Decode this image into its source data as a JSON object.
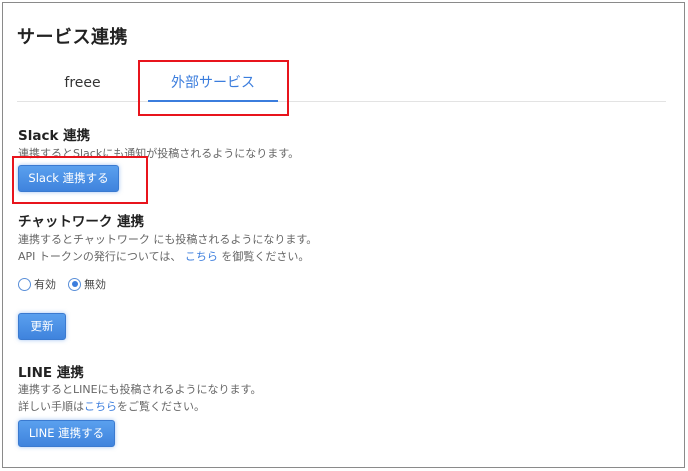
{
  "page": {
    "title": "サービス連携"
  },
  "tabs": [
    {
      "label": "freee",
      "active": false
    },
    {
      "label": "外部サービス",
      "active": true
    }
  ],
  "slack": {
    "title": "Slack 連携",
    "description": "連携するとSlackにも通知が投稿されるようになります。",
    "button_label": "Slack 連携する"
  },
  "chatwork": {
    "title": "チャットワーク 連携",
    "description_line1": "連携するとチャットワーク にも投稿されるようになります。",
    "description_line2_prefix": "API トークンの発行については、",
    "description_line2_link": "こちら",
    "description_line2_suffix": "を御覧ください。",
    "radio_options": [
      {
        "label": "有効",
        "checked": false
      },
      {
        "label": "無効",
        "checked": true
      }
    ],
    "update_button_label": "更新"
  },
  "line": {
    "title": "LINE 連携",
    "description_line1": "連携するとLINEにも投稿されるようになります。",
    "description_line2_prefix": "詳しい手順は",
    "description_line2_link": "こちら",
    "description_line2_suffix": "をご覧ください。",
    "button_label": "LINE 連携する"
  },
  "colors": {
    "accent": "#3b7ddd",
    "highlight": "#e8141c",
    "button": "#4a8fe4"
  }
}
